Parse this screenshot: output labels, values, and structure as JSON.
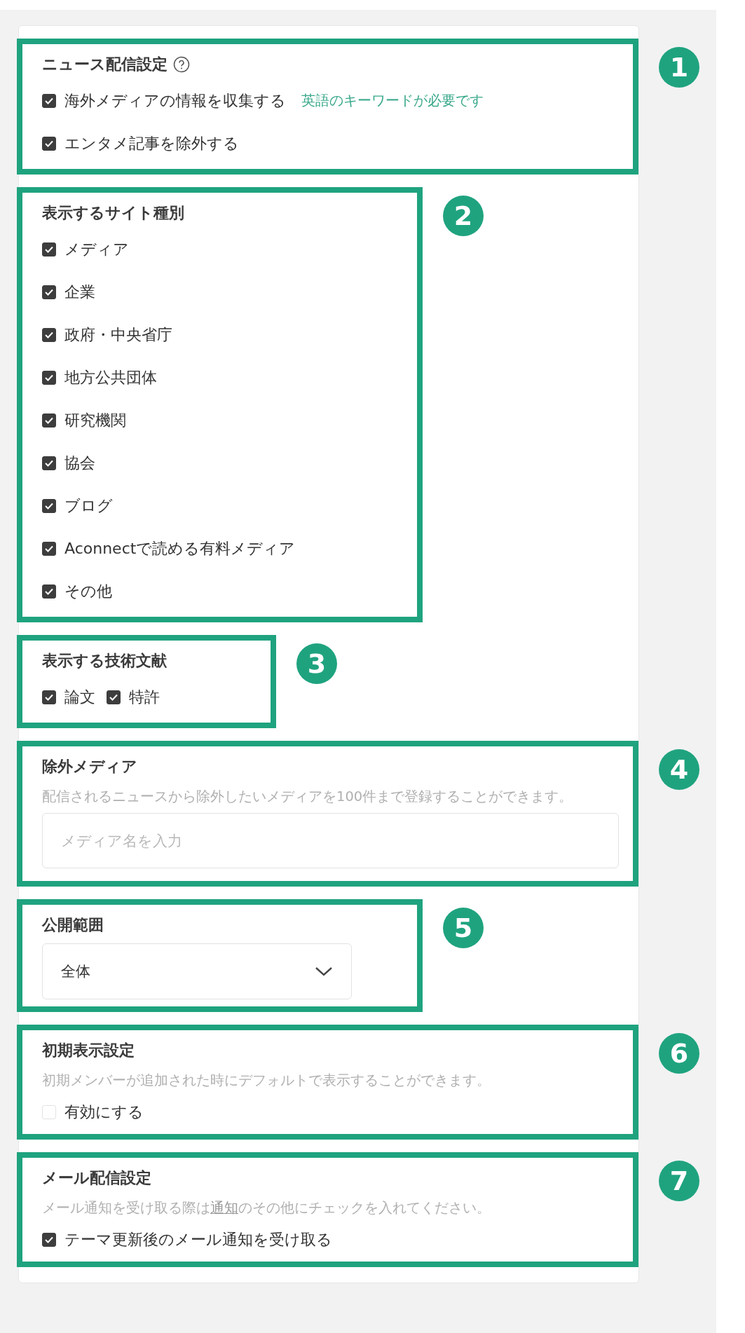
{
  "sections": [
    {
      "kind": "checks",
      "badge": "1",
      "frame": {
        "kind": "wide"
      },
      "title": "ニュース配信設定",
      "help": true,
      "items": [
        {
          "label": "海外メディアの情報を収集する",
          "checked": true,
          "note": "英語のキーワードが必要です"
        },
        {
          "label": "エンタメ記事を除外する",
          "checked": true
        }
      ]
    },
    {
      "kind": "checks",
      "badge": "2",
      "frame": {
        "kind": "medium"
      },
      "title": "表示するサイト種別",
      "items": [
        {
          "label": "メディア",
          "checked": true
        },
        {
          "label": "企業",
          "checked": true
        },
        {
          "label": "政府・中央省庁",
          "checked": true
        },
        {
          "label": "地方公共団体",
          "checked": true
        },
        {
          "label": "研究機関",
          "checked": true
        },
        {
          "label": "協会",
          "checked": true
        },
        {
          "label": "ブログ",
          "checked": true
        },
        {
          "label": "Aconnectで読める有料メディア",
          "checked": true
        },
        {
          "label": "その他",
          "checked": true
        }
      ]
    },
    {
      "kind": "inline-checks",
      "badge": "3",
      "frame": {
        "kind": "narrow"
      },
      "title": "表示する技術文献",
      "items": [
        {
          "label": "論文",
          "checked": true
        },
        {
          "label": "特許",
          "checked": true
        }
      ]
    },
    {
      "kind": "input",
      "badge": "4",
      "frame": {
        "kind": "wide"
      },
      "title": "除外メディア",
      "description": [
        {
          "text": "配信されるニュースから除外したいメディアを100件まで登録することができます。"
        }
      ],
      "placeholder": "メディア名を入力"
    },
    {
      "kind": "select",
      "badge": "5",
      "frame": {
        "kind": "medium"
      },
      "title": "公開範囲",
      "value": "全体"
    },
    {
      "kind": "checks",
      "badge": "6",
      "frame": {
        "kind": "wide"
      },
      "title": "初期表示設定",
      "description": [
        {
          "text": "初期メンバーが追加された時にデフォルトで表示することができます。"
        }
      ],
      "items": [
        {
          "label": "有効にする",
          "checked": false
        }
      ]
    },
    {
      "kind": "checks",
      "badge": "7",
      "frame": {
        "kind": "wide"
      },
      "title": "メール配信設定",
      "description": [
        {
          "text": "メール通知を受け取る際は"
        },
        {
          "text": "通知",
          "link": true
        },
        {
          "text": "のその他にチェックを入れてください。"
        }
      ],
      "items": [
        {
          "label": "テーマ更新後のメール通知を受け取る",
          "checked": true
        }
      ]
    }
  ]
}
